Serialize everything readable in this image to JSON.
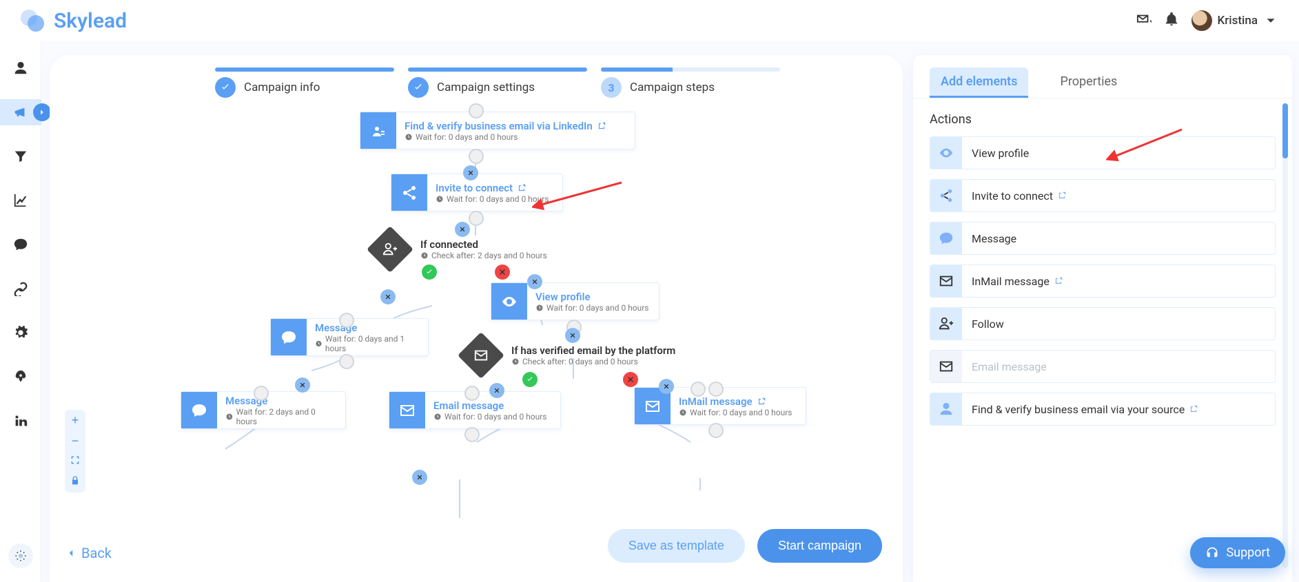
{
  "app": {
    "brand": "Skylead",
    "user_name": "Kristina"
  },
  "wizard": {
    "steps": [
      {
        "label": "Campaign info",
        "done": true,
        "progress": 100
      },
      {
        "label": "Campaign settings",
        "done": true,
        "progress": 100
      },
      {
        "label": "Campaign steps",
        "done": false,
        "num": "3",
        "progress": 40
      }
    ]
  },
  "flow": {
    "nodes": {
      "find_email": {
        "title": "Find & verify business email via LinkedIn",
        "meta": "Wait for: 0 days and 0 hours"
      },
      "invite": {
        "title": "Invite to connect",
        "meta": "Wait for: 0 days and 0 hours"
      },
      "cond_conn": {
        "title": "If connected",
        "meta": "Check after: 2 days and 0 hours"
      },
      "view_prof": {
        "title": "View profile",
        "meta": "Wait for: 0 days and 0 hours"
      },
      "msg1": {
        "title": "Message",
        "meta": "Wait for: 0 days and 1 hours"
      },
      "cond_email": {
        "title": "If has verified email by the platform",
        "meta": "Check after: 0 days and 0 hours"
      },
      "msg2": {
        "title": "Message",
        "meta": "Wait for: 2 days and 0 hours"
      },
      "email_msg": {
        "title": "Email message",
        "meta": "Wait for: 0 days and 0 hours"
      },
      "inmail": {
        "title": "InMail message",
        "meta": "Wait for: 0 days and 0 hours"
      }
    }
  },
  "panel": {
    "tabs": {
      "add": "Add elements",
      "props": "Properties"
    },
    "section": "Actions",
    "actions": [
      {
        "label": "View profile",
        "icon": "eye",
        "disabled": false
      },
      {
        "label": "Invite to connect",
        "icon": "share",
        "ext": true
      },
      {
        "label": "Message",
        "icon": "chat"
      },
      {
        "label": "InMail message",
        "icon": "inmail",
        "ext": true
      },
      {
        "label": "Follow",
        "icon": "follow"
      },
      {
        "label": "Email message",
        "icon": "mail",
        "disabled": true
      },
      {
        "label": "Find & verify business email via your source",
        "icon": "person",
        "ext": true
      }
    ]
  },
  "buttons": {
    "back": "Back",
    "save_template": "Save as template",
    "start": "Start campaign",
    "support": "Support"
  }
}
